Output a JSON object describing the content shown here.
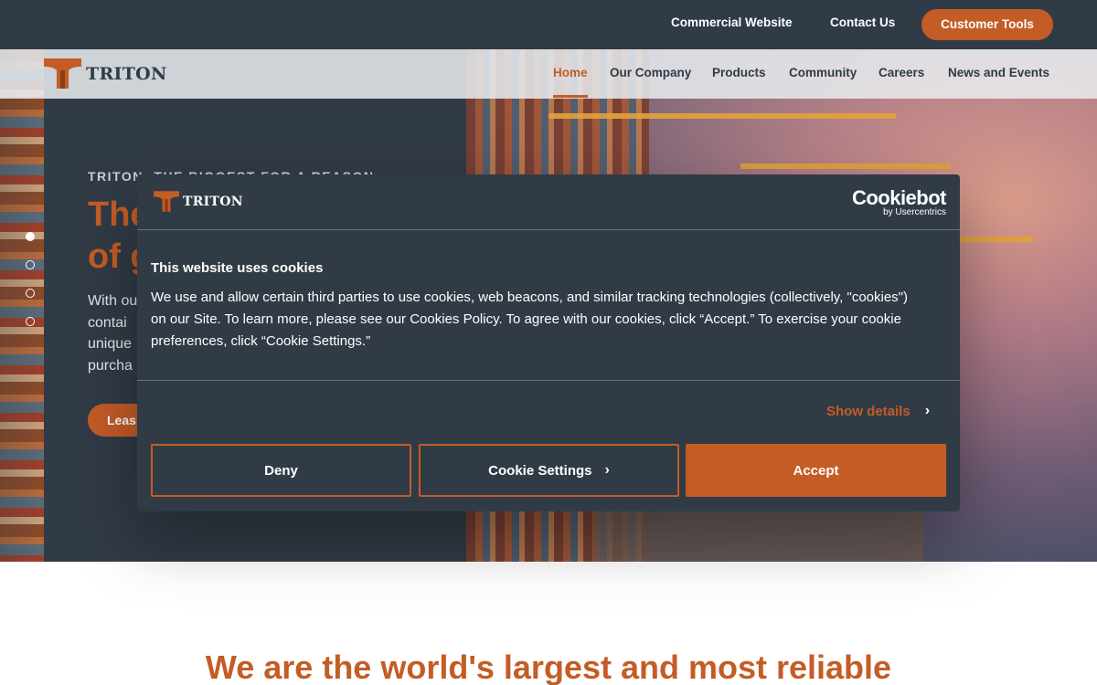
{
  "topbar": {
    "commercial": "Commercial Website",
    "contact": "Contact Us",
    "tools": "Customer Tools"
  },
  "brand": {
    "name": "TRITON",
    "accent": "#c45c26",
    "dark": "#2f3b47"
  },
  "nav": {
    "items": [
      "Home",
      "Our Company",
      "Products",
      "Community",
      "Careers",
      "News and Events"
    ],
    "active": "Home"
  },
  "hero": {
    "eyebrow": "TRITON: THE BIGGEST FOR A REASON",
    "title": "The\nof g",
    "body": "With ou\ncontai\nunique\npurcha",
    "button": "Leas"
  },
  "slider": {
    "slides": 4,
    "active_index": 0
  },
  "below": {
    "tagline": "We are the world's largest and most reliable"
  },
  "cookie": {
    "logo_text": "TRITON",
    "provider_name": "Cookiebot",
    "provider_sub": "by Usercentrics",
    "title": "This website uses cookies",
    "text": "We use and allow certain third parties to use cookies, web beacons, and similar tracking technologies (collectively, \"cookies\") on our Site. To learn more, please see our Cookies Policy. To agree with our cookies, click “Accept.” To exercise your cookie preferences, click “Cookie Settings.”",
    "show_details": "Show details",
    "deny": "Deny",
    "settings": "Cookie Settings",
    "accept": "Accept"
  },
  "icons": {
    "chevron": "chevron-right-icon",
    "logo": "triton-t-logo-icon"
  }
}
